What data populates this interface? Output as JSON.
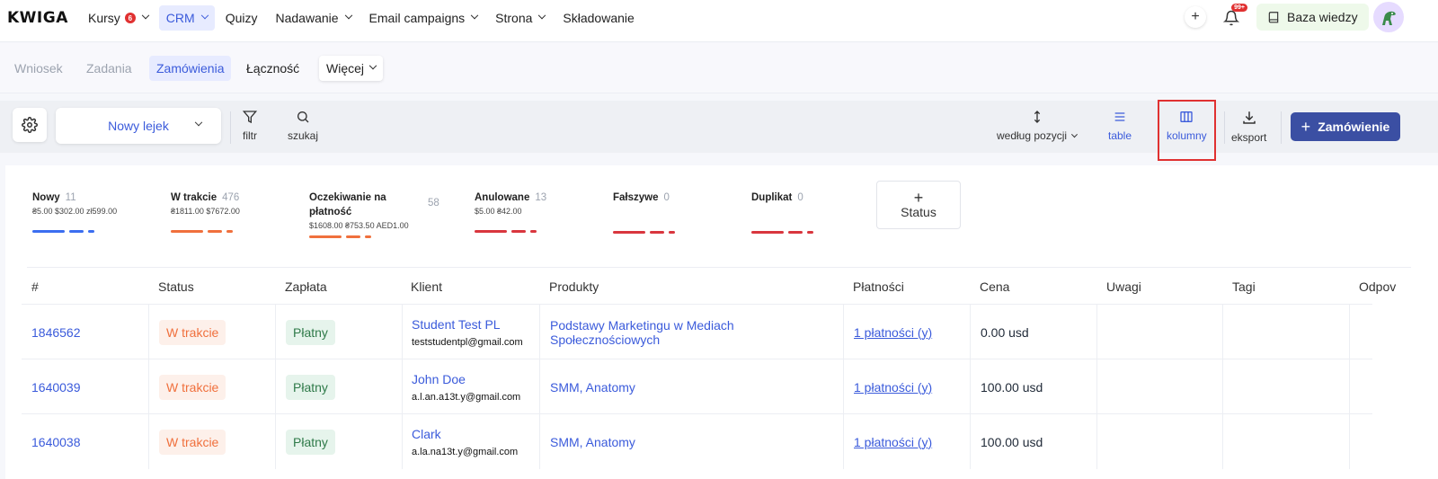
{
  "logo": "KWIGA",
  "nav": [
    {
      "label": "Kursy",
      "badge": "6"
    },
    {
      "label": "CRM"
    },
    {
      "label": "Quizy"
    },
    {
      "label": "Nadawanie"
    },
    {
      "label": "Email campaigns"
    },
    {
      "label": "Strona"
    },
    {
      "label": "Składowanie"
    }
  ],
  "top_right": {
    "plus": "+",
    "notifications_badge": "99+",
    "knowledge_base": "Baza wiedzy"
  },
  "subtabs": [
    "Wniosek",
    "Zadania",
    "Zamówienia",
    "Łączność",
    "Więcej"
  ],
  "toolbar": {
    "funnel": "Nowy lejek",
    "filter": "filtr",
    "search": "szukaj",
    "sort": "według pozycji",
    "table": "table",
    "columns": "kolumny",
    "export": "eksport",
    "add_order": "Zamówienie"
  },
  "statuses": [
    {
      "name": "Nowy",
      "count": "11",
      "amount": "₴5.00 $302.00 zł599.00",
      "color": "#3b6ef0"
    },
    {
      "name": "W trakcie",
      "count": "476",
      "amount": "₴1811.00 $7672.00",
      "color": "#f0703d"
    },
    {
      "name": "Oczekiwanie na płatność",
      "count": "58",
      "amount": "$1608.00 ₴753.50 AED1.00",
      "color": "#f0703d"
    },
    {
      "name": "Anulowane",
      "count": "13",
      "amount": "$5.00 ₴42.00",
      "color": "#d9363e"
    },
    {
      "name": "Fałszywe",
      "count": "0",
      "amount": "",
      "color": "#d9363e"
    },
    {
      "name": "Duplikat",
      "count": "0",
      "amount": "",
      "color": "#d9363e"
    }
  ],
  "add_status": {
    "plus": "+",
    "label": "Status"
  },
  "table": {
    "headers": [
      "#",
      "Status",
      "Zapłata",
      "Klient",
      "Produkty",
      "Płatności",
      "Cena",
      "Uwagi",
      "Tagi",
      "Odpov"
    ],
    "rows": [
      {
        "id": "1846562",
        "status": "W trakcie",
        "payment": "Płatny",
        "client_name": "Student Test PL",
        "client_email": "teststudentpl@gmail.com",
        "products": "Podstawy Marketingu w Mediach Społecznościowych",
        "payments": "1 płatności (y)",
        "price": "0.00 usd"
      },
      {
        "id": "1640039",
        "status": "W trakcie",
        "payment": "Płatny",
        "client_name": "John Doe",
        "client_email": "a.l.an.a13t.y@gmail.com",
        "products": "SMM, Anatomy",
        "payments": "1 płatności (y)",
        "price": "100.00 usd"
      },
      {
        "id": "1640038",
        "status": "W trakcie",
        "payment": "Płatny",
        "client_name": "Clark",
        "client_email": "a.la.na13t.y@gmail.com",
        "products": "SMM, Anatomy",
        "payments": "1 płatności (y)",
        "price": "100.00 usd"
      }
    ]
  },
  "colors": {
    "accent": "#3b5bdb",
    "primary_button": "#3b4fa3",
    "highlight_box": "#e03131"
  }
}
